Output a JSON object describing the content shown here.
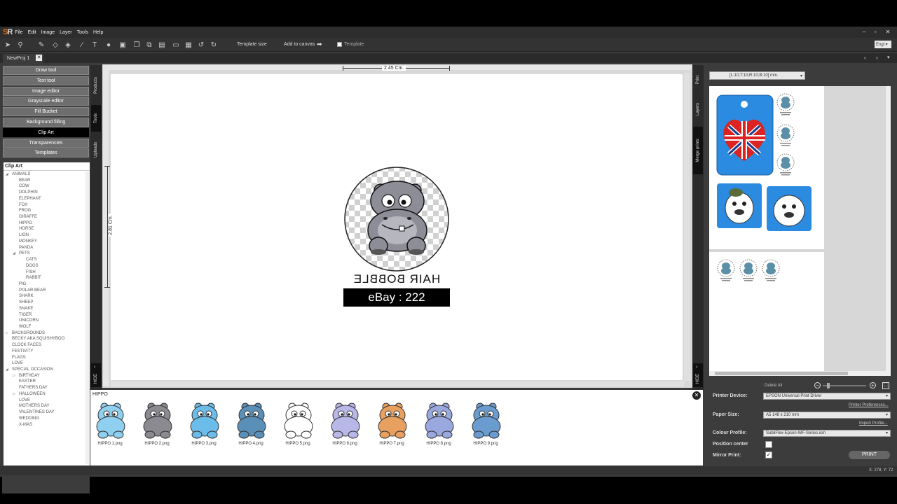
{
  "app": {
    "logo": "SR"
  },
  "menu": [
    "File",
    "Edit",
    "Image",
    "Layer",
    "Tools",
    "Help"
  ],
  "toolbar": {
    "template_size": "Template size",
    "add_to_canvas": "Add to canvas",
    "template_label": "Template",
    "lang": "Engl"
  },
  "tab": {
    "label": "NewProj 1"
  },
  "left_buttons": [
    "Draw tool",
    "Text tool",
    "Image editor",
    "Grayscale editor",
    "Fill Bucket",
    "Background filling",
    "Clip Art",
    "Transparencies",
    "Templates"
  ],
  "active_button_index": 6,
  "tree": {
    "title": "Clip Art",
    "items": [
      {
        "t": "ANIMALS",
        "lvl": 0,
        "exp": "open"
      },
      {
        "t": "BEAR",
        "lvl": 1
      },
      {
        "t": "COW",
        "lvl": 1
      },
      {
        "t": "DOLPHIN",
        "lvl": 1
      },
      {
        "t": "ELEPHANT",
        "lvl": 1
      },
      {
        "t": "FOX",
        "lvl": 1
      },
      {
        "t": "FROG",
        "lvl": 1
      },
      {
        "t": "GIRAFFE",
        "lvl": 1
      },
      {
        "t": "HIPPO",
        "lvl": 1
      },
      {
        "t": "HORSE",
        "lvl": 1
      },
      {
        "t": "LION",
        "lvl": 1
      },
      {
        "t": "MONKEY",
        "lvl": 1
      },
      {
        "t": "PANDA",
        "lvl": 1
      },
      {
        "t": "PETS",
        "lvl": 1,
        "exp": "open"
      },
      {
        "t": "CATS",
        "lvl": 2
      },
      {
        "t": "DOGS",
        "lvl": 2
      },
      {
        "t": "FISH",
        "lvl": 2
      },
      {
        "t": "RABBIT",
        "lvl": 2
      },
      {
        "t": "PIG",
        "lvl": 1
      },
      {
        "t": "POLAR BEAR",
        "lvl": 1
      },
      {
        "t": "SHARK",
        "lvl": 1
      },
      {
        "t": "SHEEP",
        "lvl": 1
      },
      {
        "t": "SNAKE",
        "lvl": 1
      },
      {
        "t": "TIGER",
        "lvl": 1
      },
      {
        "t": "UNICORN",
        "lvl": 1
      },
      {
        "t": "WOLF",
        "lvl": 1
      },
      {
        "t": "BACKGROUNDS",
        "lvl": 0,
        "exp": "closed"
      },
      {
        "t": "BECKY AKA SQUISHYBOO",
        "lvl": 0
      },
      {
        "t": "CLOCK FACES",
        "lvl": 0
      },
      {
        "t": "FESTIVITY",
        "lvl": 0
      },
      {
        "t": "FLAGS",
        "lvl": 0
      },
      {
        "t": "LOVE",
        "lvl": 0
      },
      {
        "t": "SPECIAL OCCASION",
        "lvl": 0,
        "exp": "open"
      },
      {
        "t": "BIRTHDAY",
        "lvl": 1,
        "exp": "closed"
      },
      {
        "t": "EASTER",
        "lvl": 1
      },
      {
        "t": "FATHERS DAY",
        "lvl": 1
      },
      {
        "t": "HALLOWEEN",
        "lvl": 1,
        "exp": "closed"
      },
      {
        "t": "LOVE",
        "lvl": 1
      },
      {
        "t": "MOTHERS DAY",
        "lvl": 1
      },
      {
        "t": "VALENTINES DAY",
        "lvl": 1
      },
      {
        "t": "WEDDING",
        "lvl": 1
      },
      {
        "t": "X-MAS",
        "lvl": 1
      }
    ]
  },
  "side_tabs_left": [
    "Products",
    "Tools",
    "Uploads"
  ],
  "side_tabs_right": [
    "Print",
    "Layers",
    "Merge prints"
  ],
  "hide_label": "HIDE",
  "canvas": {
    "width_label": "2.45 Cm.",
    "height_label": "2.81 Cm.",
    "mirror_text": "HAIR BOBBLE",
    "banner_text": "eBay : 222"
  },
  "thumbs": {
    "title": "HIPPO",
    "items": [
      {
        "label": "HIPPO 1.png",
        "color": "#8fd0f0"
      },
      {
        "label": "HIPPO 2.png",
        "color": "#8a8a90"
      },
      {
        "label": "HIPPO 3.png",
        "color": "#6cbcea"
      },
      {
        "label": "HIPPO 4.png",
        "color": "#5a8fb8"
      },
      {
        "label": "HIPPO 5.png",
        "color": "#ffffff"
      },
      {
        "label": "HIPPO 6.png",
        "color": "#b8b8e8"
      },
      {
        "label": "HIPPO 7.png",
        "color": "#e8a060"
      },
      {
        "label": "HIPPO 8.png",
        "color": "#9aa8e0"
      },
      {
        "label": "HIPPO 9.png",
        "color": "#6a9cd0"
      }
    ]
  },
  "print_panel": {
    "margin_select": "[L:10;T:10;R:10;B:10] mm.",
    "delete_all": "Delete All",
    "printer_device_label": "Printer Device:",
    "printer_device": "EPSON Universal Print Driver",
    "printer_prefs": "Printer Preferences...",
    "paper_size_label": "Paper Size:",
    "paper_size": "A5 148 x 210 mm",
    "import_profile": "Import Profile...",
    "colour_profile_label": "Colour Profile:",
    "colour_profile": "SubliFlex-Epson-WF-Series.icm",
    "position_center_label": "Position center",
    "position_center": false,
    "mirror_print_label": "Mirror Print:",
    "mirror_print": true,
    "print_button": "PRINT"
  },
  "status": {
    "coords": "X: 278, Y: 72"
  },
  "colors": {
    "accent": "#2b8fe0",
    "active": "#000000",
    "banner": "#000000"
  }
}
